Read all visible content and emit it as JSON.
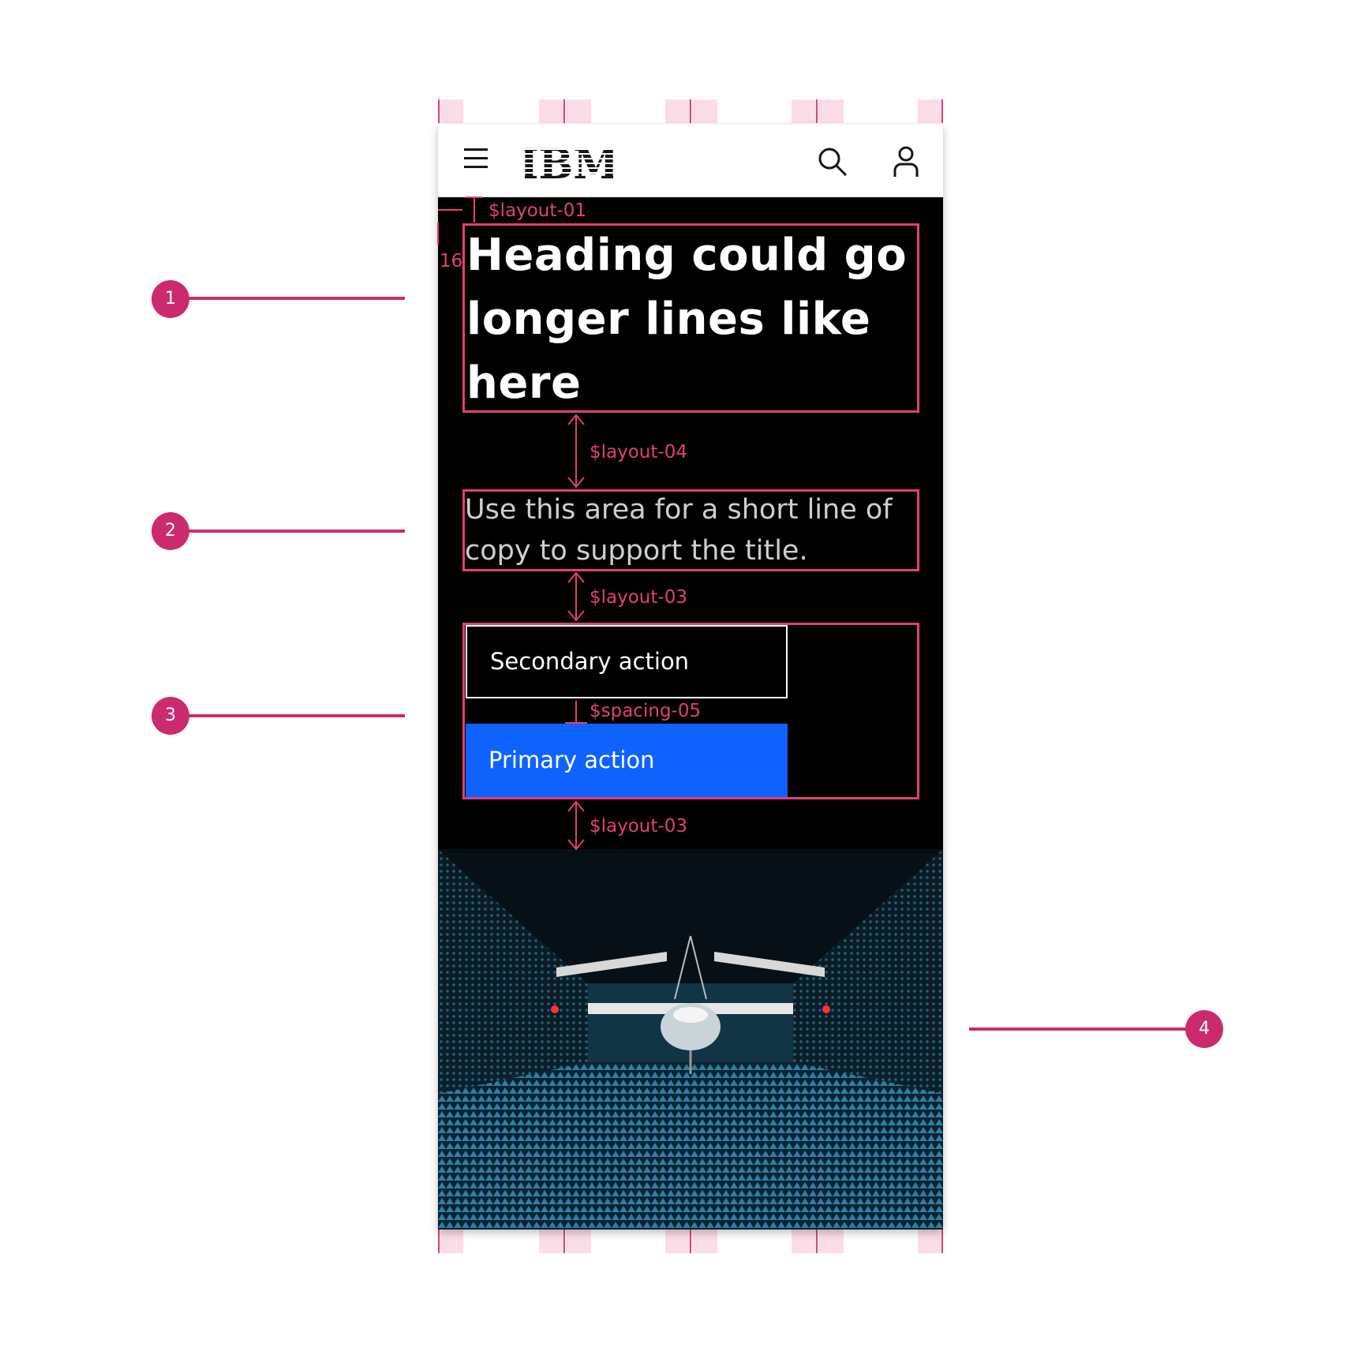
{
  "header": {
    "logo_text": "IBM",
    "menu_icon": "hamburger-icon",
    "search_icon": "search-icon",
    "user_icon": "user-icon"
  },
  "hero": {
    "heading": "Heading could go longer lines like here",
    "subcopy": "Use this area for a short line of copy to support the title.",
    "secondary_action": "Secondary action",
    "primary_action": "Primary action",
    "image_alt": "aircraft in anechoic chamber"
  },
  "annotations": {
    "layout_01": "$layout-01",
    "margin_16": "16",
    "layout_04": "$layout-04",
    "layout_03_a": "$layout-03",
    "spacing_05": "$spacing-05",
    "layout_03_b": "$layout-03"
  },
  "callouts": [
    "1",
    "2",
    "3",
    "4"
  ],
  "colors": {
    "redline": "#e0407a",
    "callout": "#cc2a6e",
    "primary_button": "#0f62fe",
    "background": "#000000"
  }
}
